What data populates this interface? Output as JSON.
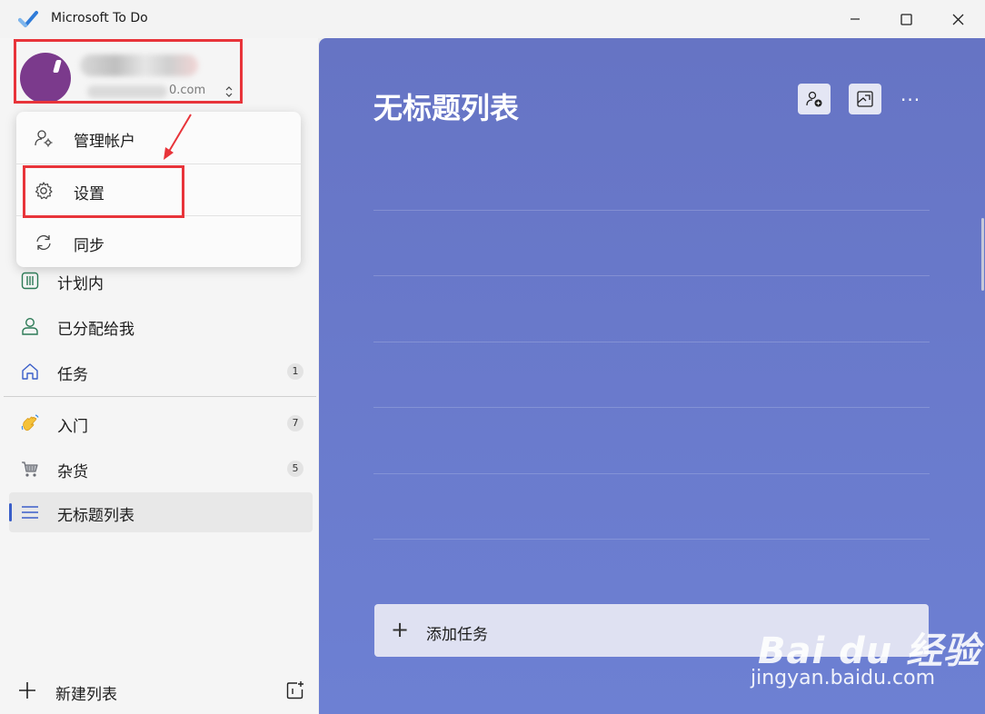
{
  "window": {
    "title": "Microsoft To Do",
    "minimize_icon": "minimize-icon",
    "maximize_icon": "maximize-icon",
    "close_icon": "close-icon"
  },
  "account": {
    "email_suffix": "0.com",
    "switch_icon": "chevron-up-down-icon"
  },
  "account_menu": {
    "items": [
      {
        "label": "管理帐户",
        "icon": "manage-account-icon"
      },
      {
        "label": "设置",
        "icon": "gear-icon"
      },
      {
        "label": "同步",
        "icon": "sync-icon"
      }
    ]
  },
  "nav": {
    "items": [
      {
        "label": "计划内",
        "icon": "calendar-icon",
        "count": ""
      },
      {
        "label": "已分配给我",
        "icon": "person-icon",
        "count": ""
      },
      {
        "label": "任务",
        "icon": "home-icon",
        "count": "1"
      }
    ],
    "lists": [
      {
        "label": "入门",
        "icon": "waving-hand-icon",
        "count": "7"
      },
      {
        "label": "杂货",
        "icon": "shopping-cart-icon",
        "count": "5"
      },
      {
        "label": "无标题列表",
        "icon": "list-icon",
        "count": ""
      }
    ]
  },
  "footer": {
    "new_list_label": "新建列表",
    "new_group_icon": "new-group-icon"
  },
  "main": {
    "list_title": "无标题列表",
    "share_icon": "share-person-icon",
    "background_icon": "background-image-icon",
    "more_label": "···",
    "add_task_label": "添加任务"
  },
  "watermark": {
    "brand": "Bai du 经验",
    "url": "jingyan.baidu.com"
  },
  "colors": {
    "accent": "#3a5ec9",
    "main_bg": "#6674c4",
    "highlight": "#e8343a"
  }
}
